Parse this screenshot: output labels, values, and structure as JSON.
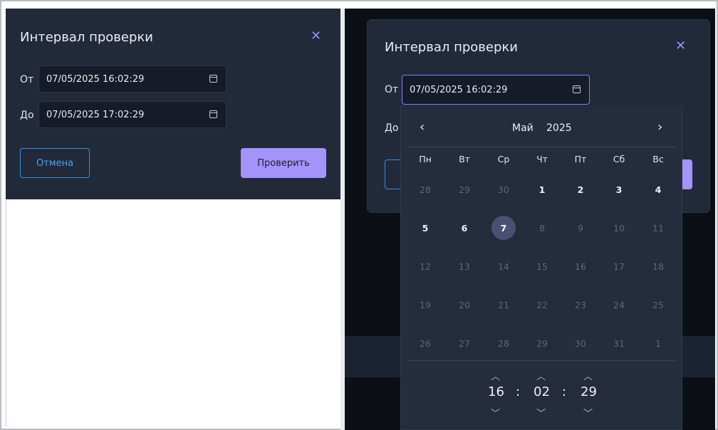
{
  "left_dialog": {
    "title": "Интервал проверки",
    "close_icon": "close-icon",
    "from_label": "От",
    "from_value": "07/05/2025 16:02:29",
    "to_label": "До",
    "to_value": "07/05/2025 17:02:29",
    "cancel_label": "Отмена",
    "check_label": "Проверить"
  },
  "right_dialog": {
    "title": "Интервал проверки",
    "close_icon": "close-icon",
    "from_label": "От",
    "from_value": "07/05/2025 16:02:29",
    "to_label": "До"
  },
  "datepicker": {
    "prev_icon": "chevron-left-icon",
    "next_icon": "chevron-right-icon",
    "month": "Май",
    "year": "2025",
    "weekdays": [
      "Пн",
      "Вт",
      "Ср",
      "Чт",
      "Пт",
      "Сб",
      "Вс"
    ],
    "weeks": [
      [
        "28",
        "29",
        "30",
        "1",
        "2",
        "3",
        "4"
      ],
      [
        "5",
        "6",
        "7",
        "8",
        "9",
        "10",
        "11"
      ],
      [
        "12",
        "13",
        "14",
        "15",
        "16",
        "17",
        "18"
      ],
      [
        "19",
        "20",
        "21",
        "22",
        "23",
        "24",
        "25"
      ],
      [
        "26",
        "27",
        "28",
        "29",
        "30",
        "31",
        "1"
      ]
    ],
    "bright_days": [
      "1",
      "2",
      "3",
      "4",
      "5",
      "6"
    ],
    "selected_day": "7",
    "time": {
      "hours": "16",
      "minutes": "02",
      "seconds": "29",
      "separator": ":"
    }
  },
  "colors": {
    "accent": "#a493fb",
    "cancel_border": "#3a8dd8",
    "dialog_bg": "#222a39",
    "selected_day_bg": "#4a4f73"
  }
}
